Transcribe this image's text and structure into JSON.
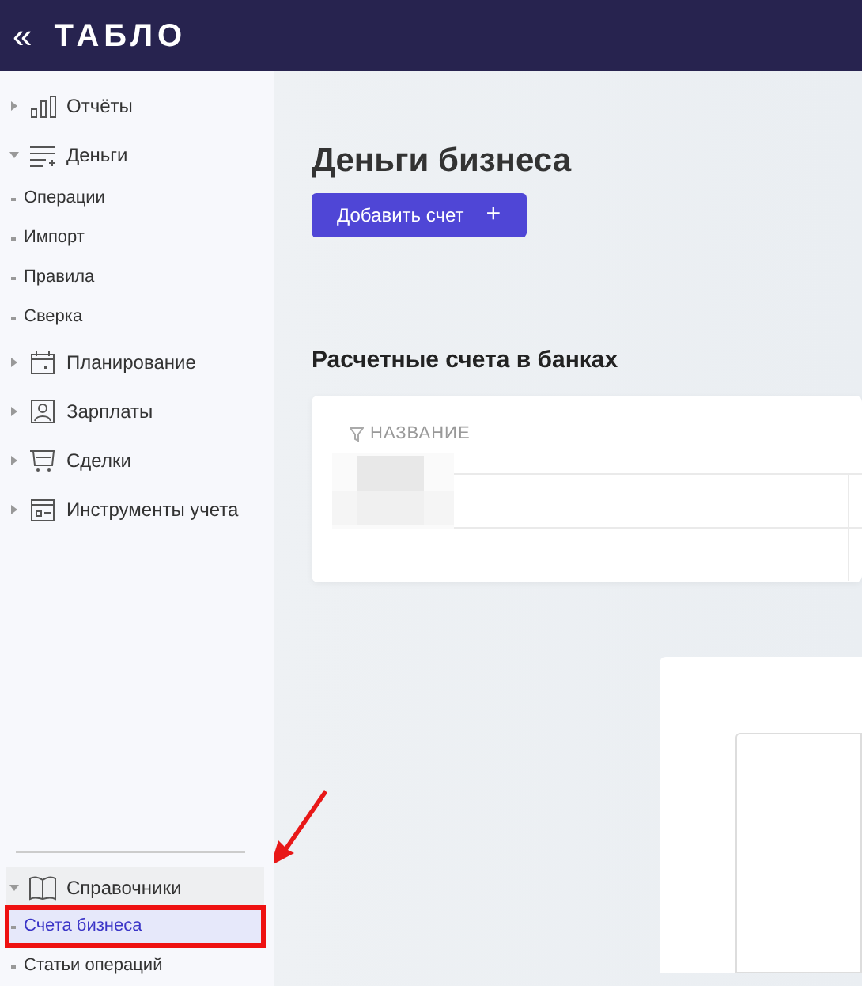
{
  "header": {
    "collapse_icon": "«",
    "logo": "ТАБЛО"
  },
  "sidebar": {
    "sections": [
      {
        "label": "Отчёты",
        "kind": "chart",
        "expanded": false
      },
      {
        "label": "Деньги",
        "kind": "list",
        "expanded": true,
        "children": [
          {
            "label": "Операции",
            "selected": false
          },
          {
            "label": "Импорт",
            "selected": false
          },
          {
            "label": "Правила",
            "selected": false
          },
          {
            "label": "Сверка",
            "selected": false
          }
        ]
      },
      {
        "label": "Планирование",
        "kind": "calendar",
        "expanded": false
      },
      {
        "label": "Зарплаты",
        "kind": "person",
        "expanded": false
      },
      {
        "label": "Сделки",
        "kind": "cart",
        "expanded": false
      },
      {
        "label": "Инструменты учета",
        "kind": "tool",
        "expanded": false
      }
    ],
    "footer_sections": [
      {
        "label": "Справочники",
        "kind": "book",
        "expanded": true,
        "children": [
          {
            "label": "Счета бизнеса",
            "selected": true
          },
          {
            "label": "Статьи операций",
            "selected": false
          }
        ]
      }
    ]
  },
  "main": {
    "title": "Деньги бизнеса",
    "add_button": {
      "label": "Добавить счет",
      "icon": "+"
    },
    "section_title": "Расчетные счета в банках",
    "table": {
      "columns": [
        {
          "label": "НАЗВАНИЕ"
        }
      ]
    }
  }
}
